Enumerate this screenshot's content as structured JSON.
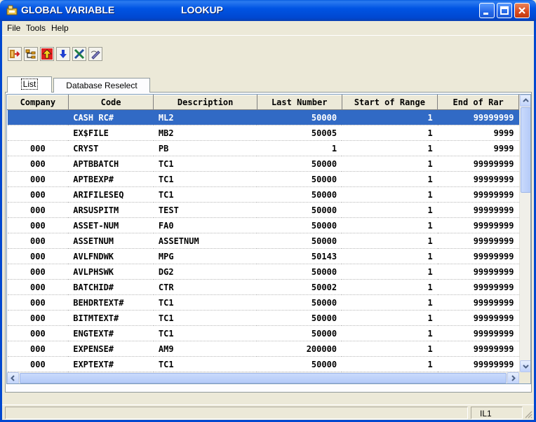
{
  "window": {
    "title_part1": "GLOBAL VARIABLE",
    "title_part2": "LOOKUP"
  },
  "menu": [
    "File",
    "Tools",
    "Help"
  ],
  "toolbar": {
    "buttons": [
      "exit-icon",
      "tree-icon",
      "up-arrow-icon",
      "down-arrow-icon",
      "tools-icon",
      "edit-icon"
    ]
  },
  "tabs": {
    "list": "List",
    "database_reselect": "Database Reselect"
  },
  "grid": {
    "columns": [
      "Company",
      "Code",
      "Description",
      "Last Number",
      "Start of Range",
      "End of Rar"
    ],
    "rows": [
      {
        "company": "",
        "code": "CASH RC#",
        "description": "ML2",
        "last": "50000",
        "start": "1",
        "end": "99999999",
        "selected": true
      },
      {
        "company": "",
        "code": "EX$FILE",
        "description": "MB2",
        "last": "50005",
        "start": "1",
        "end": "9999"
      },
      {
        "company": "000",
        "code": "CRYST",
        "description": "PB",
        "last": "1",
        "start": "1",
        "end": "9999"
      },
      {
        "company": "000",
        "code": "APTBBATCH",
        "description": "TC1",
        "last": "50000",
        "start": "1",
        "end": "99999999"
      },
      {
        "company": "000",
        "code": "APTBEXP#",
        "description": "TC1",
        "last": "50000",
        "start": "1",
        "end": "99999999"
      },
      {
        "company": "000",
        "code": "ARIFILESEQ",
        "description": "TC1",
        "last": "50000",
        "start": "1",
        "end": "99999999"
      },
      {
        "company": "000",
        "code": "ARSUSPITM",
        "description": "TEST",
        "last": "50000",
        "start": "1",
        "end": "99999999"
      },
      {
        "company": "000",
        "code": "ASSET-NUM",
        "description": "FA0",
        "last": "50000",
        "start": "1",
        "end": "99999999"
      },
      {
        "company": "000",
        "code": "ASSETNUM",
        "description": "ASSETNUM",
        "last": "50000",
        "start": "1",
        "end": "99999999"
      },
      {
        "company": "000",
        "code": "AVLFNDWK",
        "description": "MPG",
        "last": "50143",
        "start": "1",
        "end": "99999999"
      },
      {
        "company": "000",
        "code": "AVLPHSWK",
        "description": "DG2",
        "last": "50000",
        "start": "1",
        "end": "99999999"
      },
      {
        "company": "000",
        "code": "BATCHID#",
        "description": "CTR",
        "last": "50002",
        "start": "1",
        "end": "99999999"
      },
      {
        "company": "000",
        "code": "BEHDRTEXT#",
        "description": "TC1",
        "last": "50000",
        "start": "1",
        "end": "99999999"
      },
      {
        "company": "000",
        "code": "BITMTEXT#",
        "description": "TC1",
        "last": "50000",
        "start": "1",
        "end": "99999999"
      },
      {
        "company": "000",
        "code": "ENGTEXT#",
        "description": "TC1",
        "last": "50000",
        "start": "1",
        "end": "99999999"
      },
      {
        "company": "000",
        "code": "EXPENSE#",
        "description": "AM9",
        "last": "200000",
        "start": "1",
        "end": "99999999"
      },
      {
        "company": "000",
        "code": "EXPTEXT#",
        "description": "TC1",
        "last": "50000",
        "start": "1",
        "end": "99999999"
      }
    ]
  },
  "status": {
    "right": "IL1"
  }
}
